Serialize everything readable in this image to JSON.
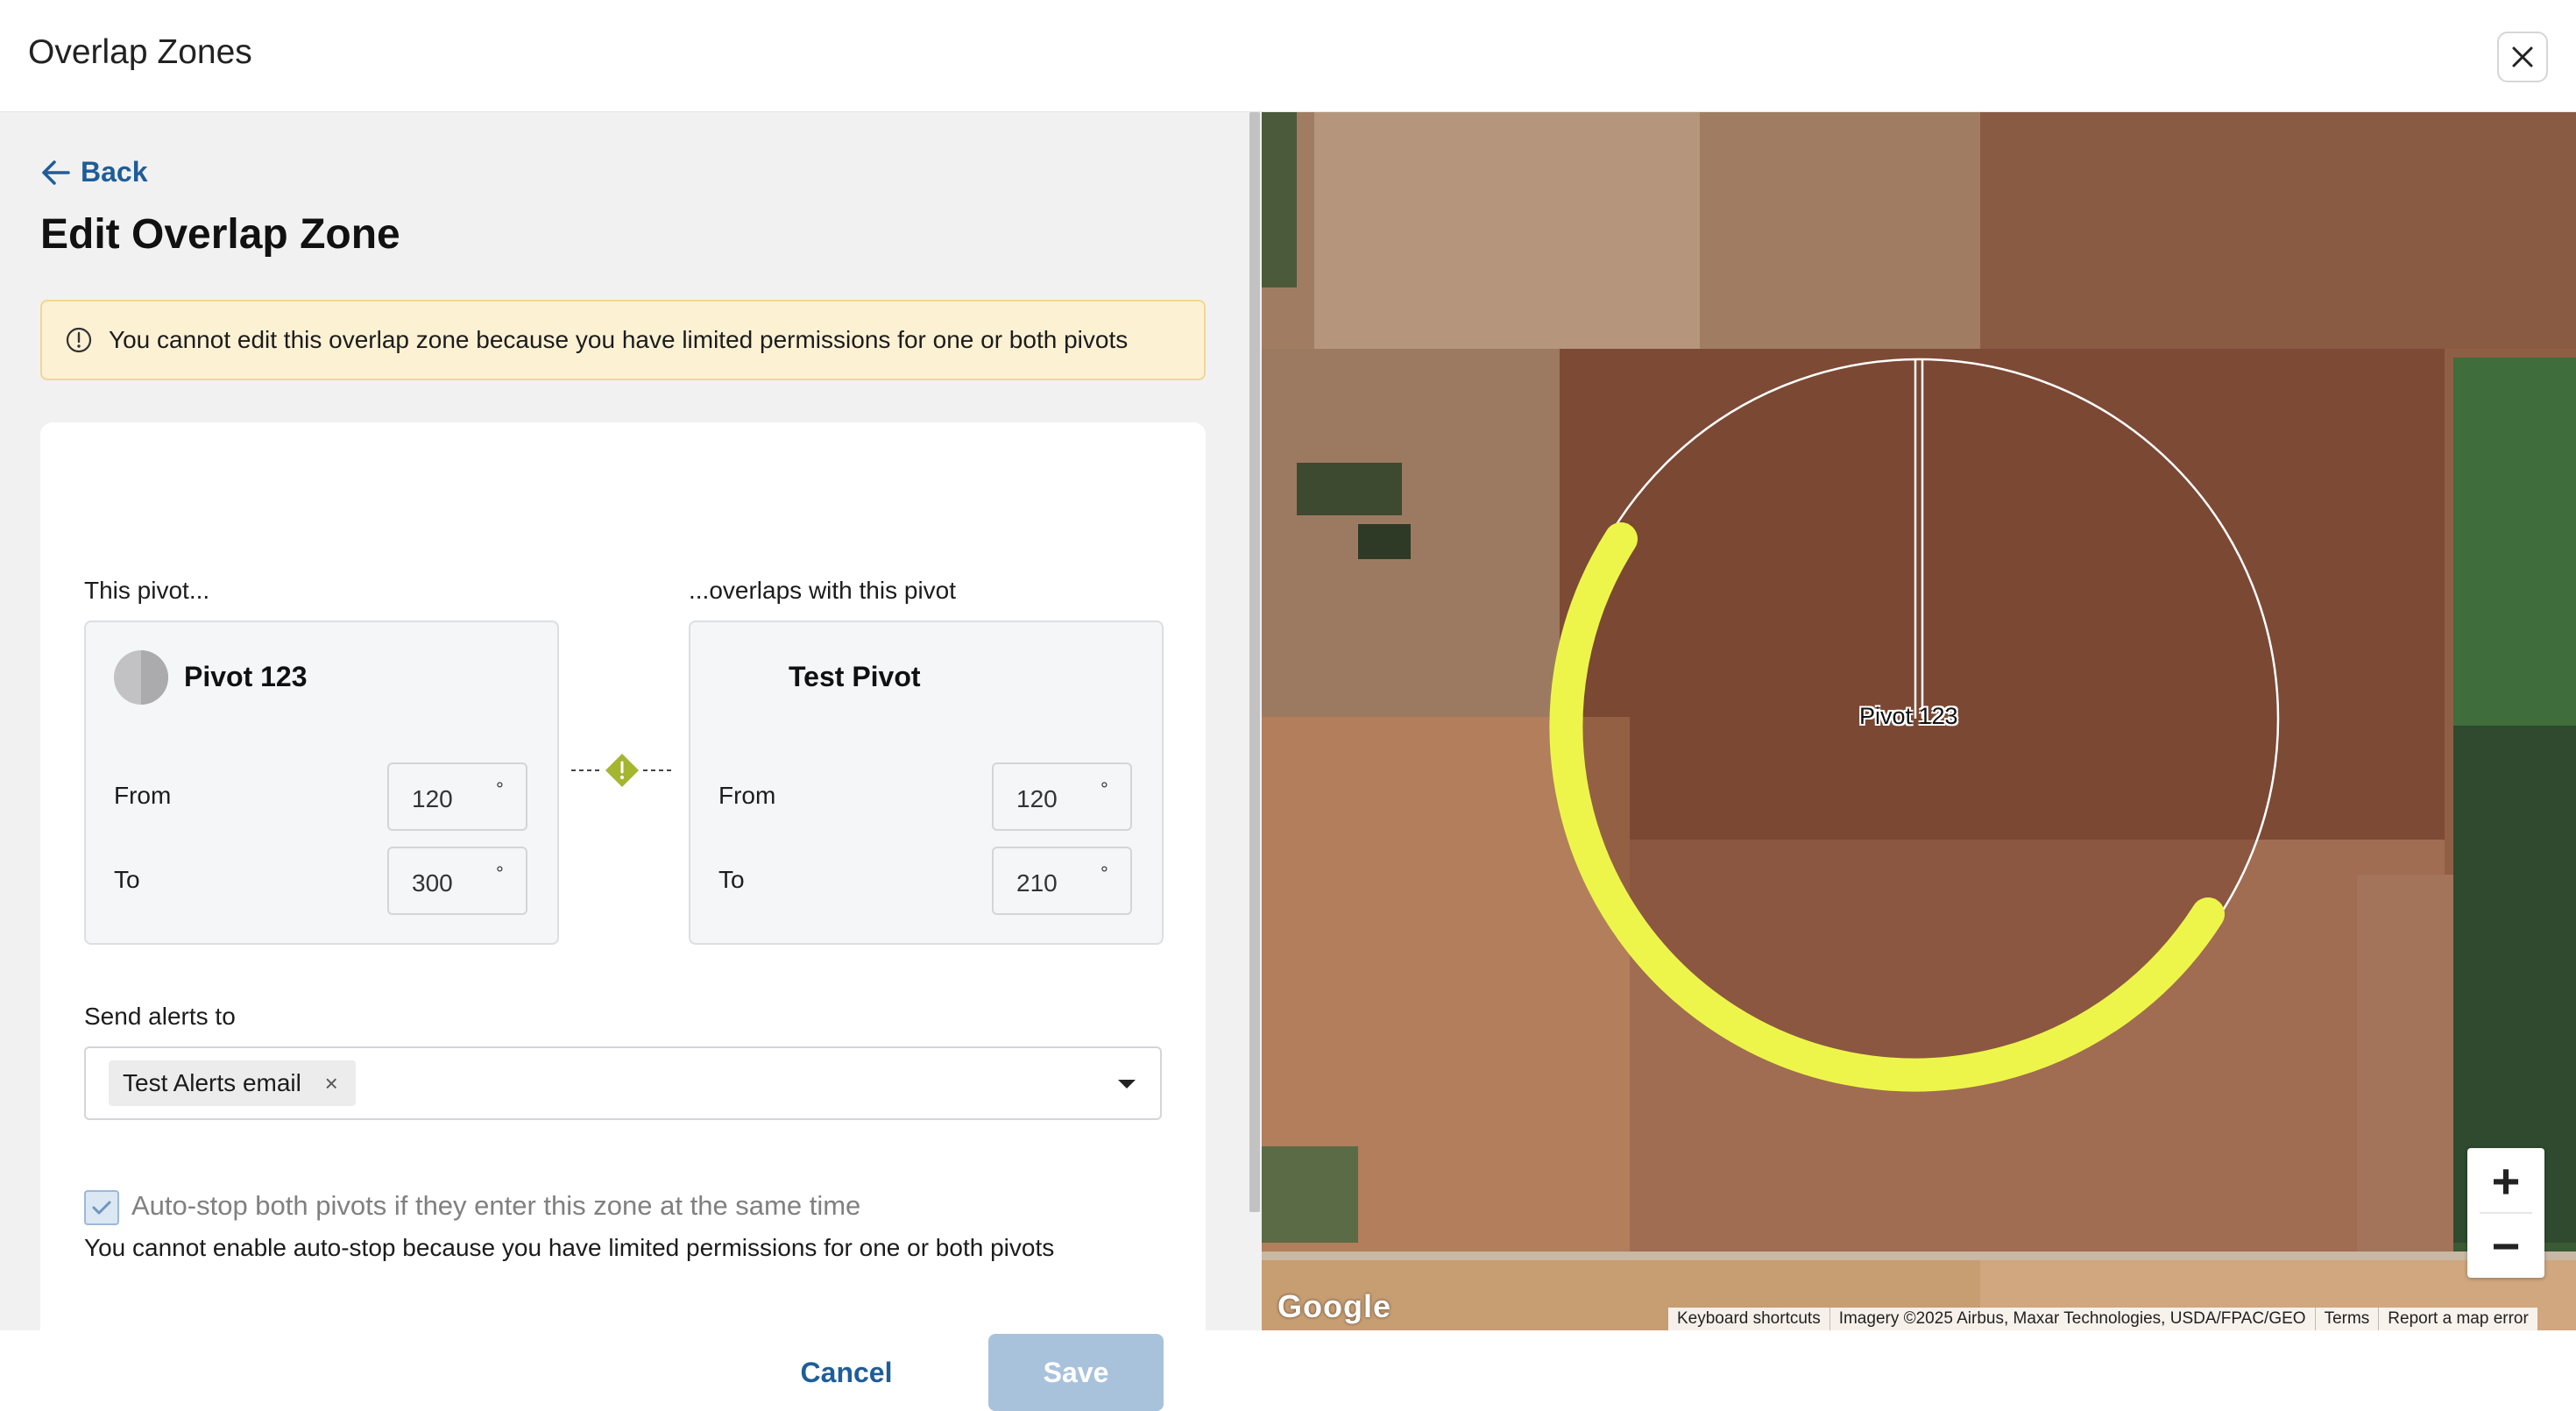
{
  "app": {
    "title": "Overlap Zones"
  },
  "nav": {
    "back_label": "Back"
  },
  "page": {
    "title": "Edit Overlap Zone"
  },
  "banner": {
    "message": "You cannot edit this overlap zone because you have limited permissions for one or both pivots"
  },
  "form": {
    "this_pivot_label": "This pivot...",
    "overlaps_label": "...overlaps with this pivot",
    "pivot_a": {
      "name": "Pivot 123",
      "from_label": "From",
      "from_value": "120",
      "to_label": "To",
      "to_value": "300",
      "degree_symbol": "°"
    },
    "pivot_b": {
      "name": "Test Pivot",
      "from_label": "From",
      "from_value": "120",
      "to_label": "To",
      "to_value": "210",
      "degree_symbol": "°"
    },
    "alerts_label": "Send alerts to",
    "alert_chip": "Test Alerts email",
    "alert_chip_remove": "×",
    "autostop_label": "Auto-stop both pivots if they enter this zone at the same time",
    "autostop_checked": true,
    "autostop_note": "You cannot enable auto-stop because you have limited permissions for one or both pivots",
    "cancel_label": "Cancel",
    "save_label": "Save"
  },
  "map": {
    "pivot_label": "Pivot 123",
    "zoom_in": "+",
    "zoom_out": "−",
    "logo": "Google",
    "attribution": [
      "Keyboard shortcuts",
      "Imagery ©2025 Airbus, Maxar Technologies, USDA/FPAC/GEO",
      "Terms",
      "Report a map error"
    ],
    "overlap_color": "#eef54a"
  },
  "colors": {
    "accent": "#1f5d99",
    "warning_bg": "#fdf1d4",
    "warning_border": "#f2d792",
    "connector_warning": "#a4b530",
    "save_disabled": "#a9c2dc"
  }
}
